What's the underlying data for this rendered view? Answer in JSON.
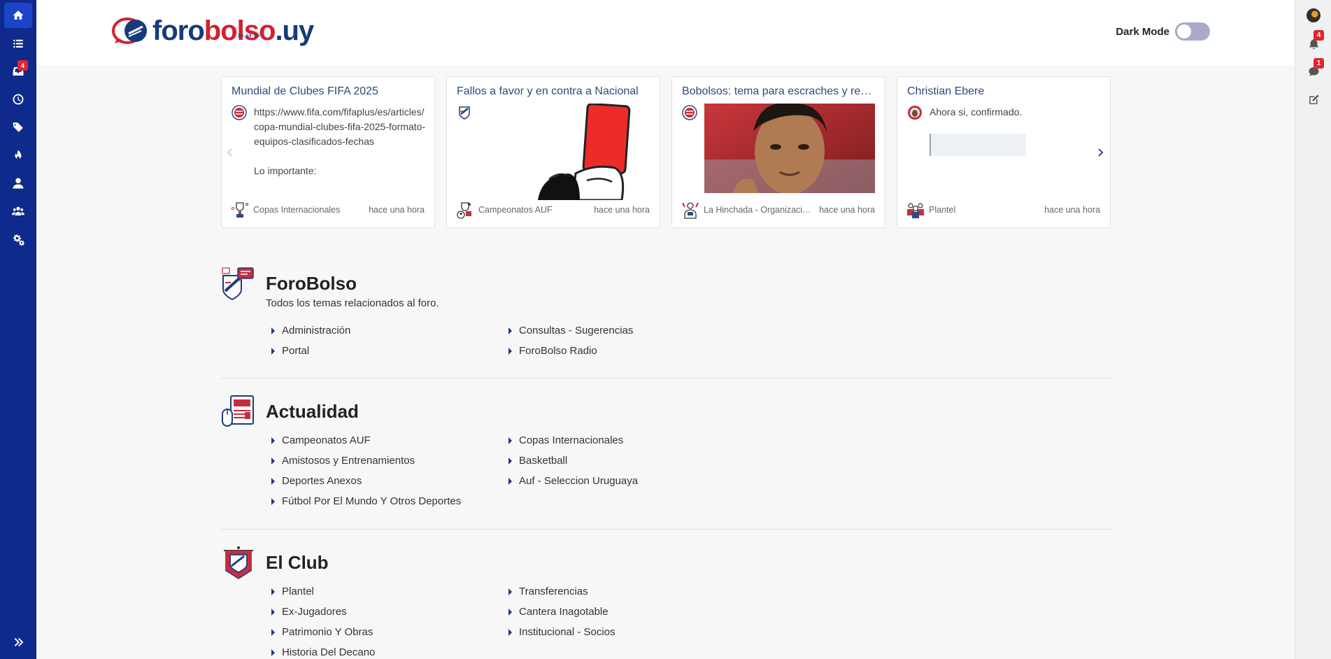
{
  "left_nav": {
    "items": [
      {
        "name": "home-icon",
        "active": true
      },
      {
        "name": "list-icon"
      },
      {
        "name": "inbox-icon",
        "badge": "4"
      },
      {
        "name": "clock-icon"
      },
      {
        "name": "tags-icon"
      },
      {
        "name": "fire-icon"
      },
      {
        "name": "user-icon"
      },
      {
        "name": "group-icon"
      },
      {
        "name": "cogs-icon"
      }
    ],
    "expand_icon": "double-chevron-right-icon"
  },
  "right_nav": {
    "notifications_badge": "4",
    "chats_badge": "1"
  },
  "header": {
    "logo_text_1": "foro",
    "logo_text_2": "bolso",
    "logo_text_3": ".uy",
    "logo_tagline": "24-09-06",
    "dark_mode_label": "Dark Mode"
  },
  "carousel": {
    "cards": [
      {
        "title": "Mundial de Clubes FIFA 2025",
        "text_1": "https://www.fifa.com/fifaplus/es/articles/copa-mundial-clubes-fifa-2025-formato-equipos-clasificados-fechas",
        "text_2": "Lo importante:",
        "category": "Copas Internacionales",
        "time": "hace una hora"
      },
      {
        "title": "Fallos a favor y en contra a Nacional",
        "category": "Campeonatos AUF",
        "time": "hace una hora"
      },
      {
        "title": "Bobolsos: tema para escraches y reclamos",
        "category": "La Hinchada - Organizaciones",
        "time": "hace una hora"
      },
      {
        "title": "Christian Ebere",
        "text_1": "Ahora si, confirmado.",
        "category": "Plantel",
        "time": "hace una hora"
      }
    ]
  },
  "categories": [
    {
      "title": "ForoBolso",
      "description": "Todos los temas relacionados al foro.",
      "children": [
        "Administración",
        "Consultas - Sugerencias",
        "Portal",
        "ForoBolso Radio"
      ]
    },
    {
      "title": "Actualidad",
      "description": "",
      "children": [
        "Campeonatos AUF",
        "Copas Internacionales",
        "Amistosos y Entrenamientos",
        "Basketball",
        "Deportes Anexos",
        "Auf - Seleccion Uruguaya",
        "Fútbol Por El Mundo Y Otros Deportes"
      ]
    },
    {
      "title": "El Club",
      "description": "",
      "children": [
        "Plantel",
        "Transferencias",
        "Ex-Jugadores",
        "Cantera Inagotable",
        "Patrimonio Y Obras",
        "Institucional - Socios",
        "Historia Del Decano"
      ]
    }
  ],
  "colors": {
    "sidebar": "#0d2a8c",
    "brand_blue": "#173a7a",
    "brand_red": "#d42030",
    "badge": "#e0262f"
  }
}
